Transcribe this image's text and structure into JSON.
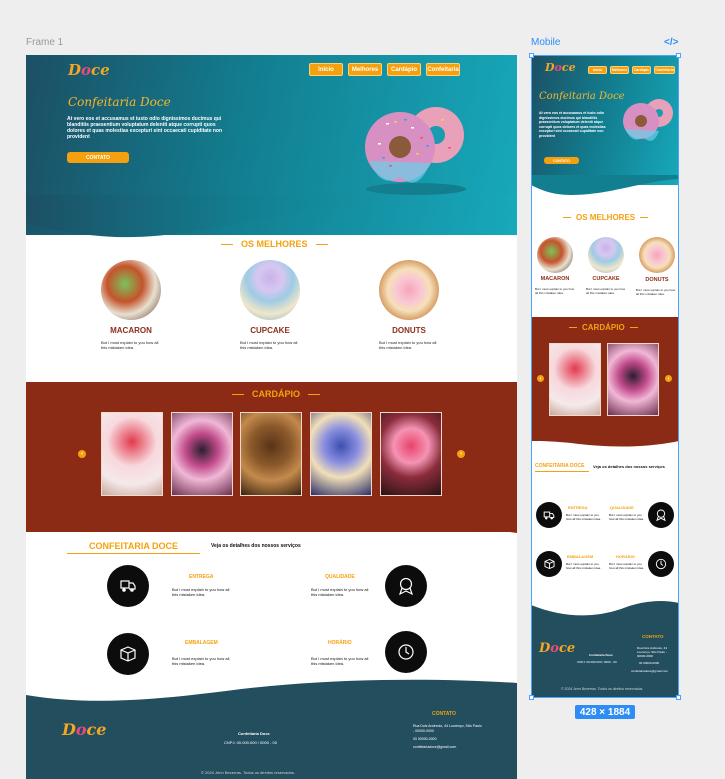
{
  "canvas": {
    "frame_label": "Frame 1",
    "mobile_label": "Mobile",
    "code_icon": "</>",
    "size_badge": "428 × 1884"
  },
  "brand": {
    "logo_d": "D",
    "logo_o": "o",
    "logo_rest": "ce",
    "accent": "#f5a10f",
    "teal": "#17a9bb",
    "brown": "#8b2b15",
    "dark_teal": "#234e5e"
  },
  "nav": [
    "Início",
    "Melhores",
    "Cardápio",
    "Confeitaria"
  ],
  "hero": {
    "title": "Confeitaria Doce",
    "text": "At vero eos et accusamus et iusto odio dignissimos ducimus qui blanditiis praesentium voluptatum deleniti atque corrupti quos dolores et quas molestias excepturi sint occaecati cupiditate non provident",
    "button": "CONTATO"
  },
  "best": {
    "title": "OS MELHORES",
    "items": [
      {
        "name": "MACARON",
        "desc": "But I must explain to you how all this mistaken idea."
      },
      {
        "name": "CUPCAKE",
        "desc": "But I must explain to you how all this mistaken idea."
      },
      {
        "name": "DONUTS",
        "desc": "But I must explain to you how all this mistaken idea."
      }
    ]
  },
  "menu": {
    "title": "CARDÁPIO",
    "prev": "‹",
    "next": "›"
  },
  "services": {
    "title": "CONFEITARIA DOCE",
    "subtitle": "Veja os detalhes dos nossos serviços",
    "items": [
      {
        "title": "ENTREGA",
        "desc": "But I must explain to you how all this mistaken idea.",
        "icon": "delivery-icon"
      },
      {
        "title": "QUALIDADE",
        "desc": "But I must explain to you how all this mistaken idea.",
        "icon": "award-icon"
      },
      {
        "title": "EMBALAGEM",
        "desc": "But I must explain to you how all this mistaken idea.",
        "icon": "package-icon"
      },
      {
        "title": "HORÁRIO",
        "desc": "But I must explain to you how all this mistaken idea.",
        "icon": "clock-icon"
      }
    ]
  },
  "footer": {
    "company": "Confeitaria Doce",
    "cnpj": "CNPJ: 00.000.000 / 0000 - 00",
    "contact_title": "CONTATO",
    "address": "Rua Dois Andreolo, 44 Lourenço, São Paulo - 00000-0000",
    "phone": "00 00000-0000",
    "email": "confeitariadoce@gmail.com",
    "copyright": "© 2024 Jenn Bezerras. Todos os direitos reservados."
  }
}
